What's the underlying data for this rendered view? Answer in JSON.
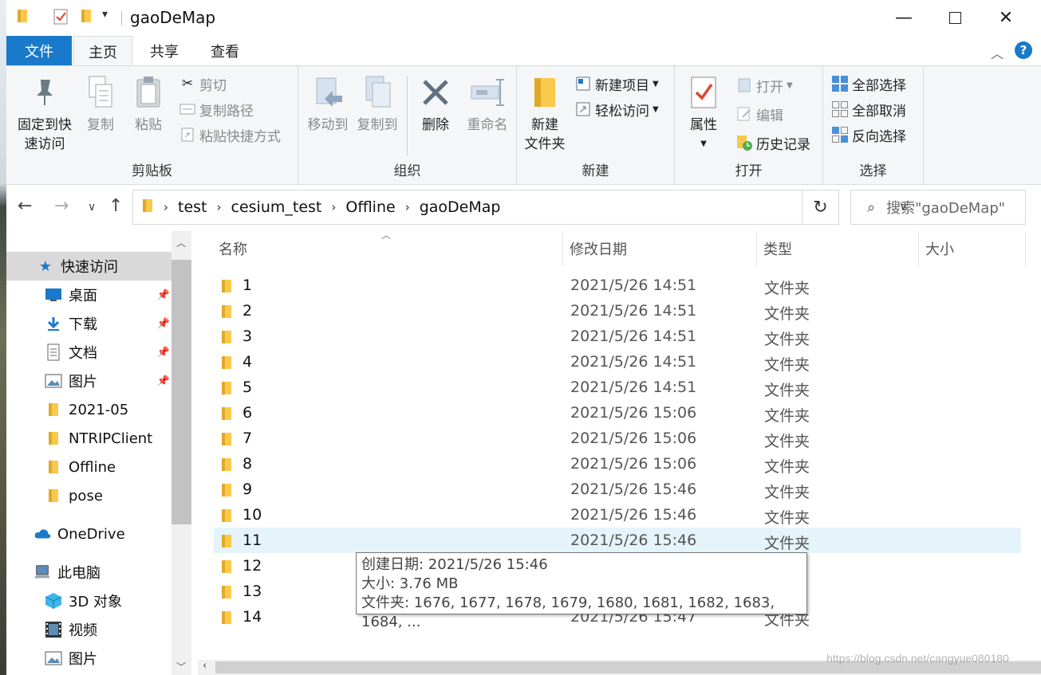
{
  "window": {
    "title": "gaoDeMap"
  },
  "ribbon_tabs": [
    "文件",
    "主页",
    "共享",
    "查看"
  ],
  "clipboard": {
    "pin_label": "固定到快\n速访问",
    "copy_label": "复制",
    "paste_label": "粘贴",
    "cut_label": "剪切",
    "copy_path_label": "复制路径",
    "paste_shortcut_label": "粘贴快捷方式",
    "group_label": "剪贴板"
  },
  "organize": {
    "move_to_label": "移动到",
    "copy_to_label": "复制到",
    "delete_label": "删除",
    "rename_label": "重命名",
    "group_label": "组织"
  },
  "new_group": {
    "new_folder_label": "新建\n文件夹",
    "new_item_label": "新建项目",
    "easy_access_label": "轻松访问",
    "group_label": "新建"
  },
  "open_group": {
    "properties_label": "属性",
    "open_label": "打开",
    "edit_label": "编辑",
    "history_label": "历史记录",
    "group_label": "打开"
  },
  "select_group": {
    "select_all_label": "全部选择",
    "select_none_label": "全部取消",
    "invert_label": "反向选择",
    "group_label": "选择"
  },
  "breadcrumb": [
    "test",
    "cesium_test",
    "Offline",
    "gaoDeMap"
  ],
  "search": {
    "placeholder": "搜索\"gaoDeMap\""
  },
  "nav_pane": {
    "quick_access": "快速访问",
    "pinned": [
      {
        "label": "桌面",
        "icon": "desktop-icon"
      },
      {
        "label": "下载",
        "icon": "download-icon"
      },
      {
        "label": "文档",
        "icon": "document-icon"
      },
      {
        "label": "图片",
        "icon": "pictures-icon"
      }
    ],
    "recent": [
      "2021-05",
      "NTRIPClient",
      "Offline",
      "pose"
    ],
    "onedrive": "OneDrive",
    "this_pc": "此电脑",
    "pc_items": [
      {
        "label": "3D 对象",
        "icon": "3d-objects-icon"
      },
      {
        "label": "视频",
        "icon": "videos-icon"
      },
      {
        "label": "图片",
        "icon": "pictures-icon"
      }
    ]
  },
  "columns": {
    "name": "名称",
    "date": "修改日期",
    "type": "类型",
    "size": "大小"
  },
  "files": [
    {
      "name": "1",
      "date": "2021/5/26 14:51",
      "type": "文件夹"
    },
    {
      "name": "2",
      "date": "2021/5/26 14:51",
      "type": "文件夹"
    },
    {
      "name": "3",
      "date": "2021/5/26 14:51",
      "type": "文件夹"
    },
    {
      "name": "4",
      "date": "2021/5/26 14:51",
      "type": "文件夹"
    },
    {
      "name": "5",
      "date": "2021/5/26 14:51",
      "type": "文件夹"
    },
    {
      "name": "6",
      "date": "2021/5/26 15:06",
      "type": "文件夹"
    },
    {
      "name": "7",
      "date": "2021/5/26 15:06",
      "type": "文件夹"
    },
    {
      "name": "8",
      "date": "2021/5/26 15:06",
      "type": "文件夹"
    },
    {
      "name": "9",
      "date": "2021/5/26 15:46",
      "type": "文件夹"
    },
    {
      "name": "10",
      "date": "2021/5/26 15:46",
      "type": "文件夹"
    },
    {
      "name": "11",
      "date": "2021/5/26 15:46",
      "type": "文件夹",
      "selected": true
    },
    {
      "name": "12",
      "date": "",
      "type": ""
    },
    {
      "name": "13",
      "date": "",
      "type": ""
    },
    {
      "name": "14",
      "date": "2021/5/26 15:47",
      "type": "文件夹"
    }
  ],
  "tooltip": {
    "created": "创建日期: 2021/5/26 15:46",
    "size": "大小: 3.76 MB",
    "folders": "文件夹: 1676, 1677, 1678, 1679, 1680, 1681, 1682, 1683, 1684, ..."
  },
  "watermark": "https://blog.csdn.net/cangyue080180",
  "colors": {
    "accent": "#1979ca",
    "folder": "#f8c94b",
    "selected_row": "#e5f3fb",
    "ribbon_bg": "#f5f6f7"
  }
}
